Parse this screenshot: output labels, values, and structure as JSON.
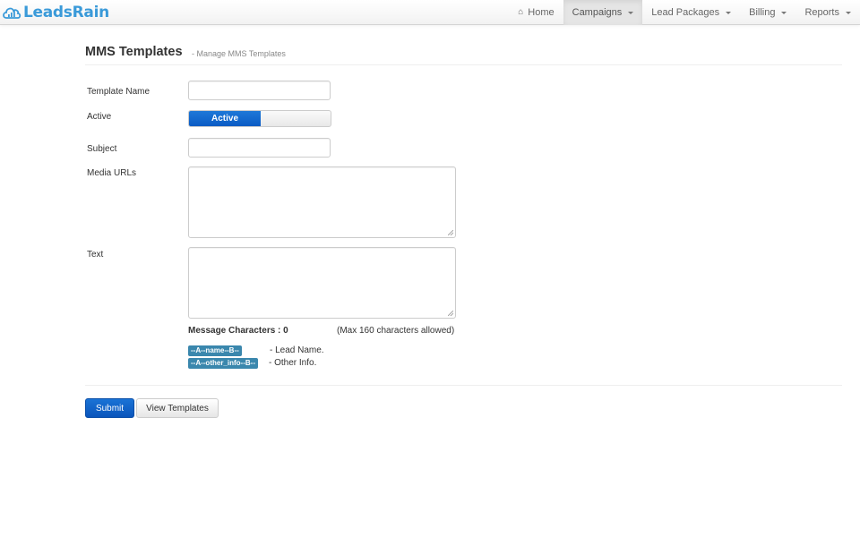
{
  "brand": {
    "name": "LeadsRain"
  },
  "nav": {
    "items": [
      {
        "label": "Home",
        "icon": "home-icon",
        "dropdown": false,
        "active": false
      },
      {
        "label": "Campaigns",
        "dropdown": true,
        "active": true
      },
      {
        "label": "Lead Packages",
        "dropdown": true,
        "active": false
      },
      {
        "label": "Billing",
        "dropdown": true,
        "active": false
      },
      {
        "label": "Reports",
        "dropdown": true,
        "active": false
      }
    ]
  },
  "header": {
    "title": "MMS Templates",
    "subtitle": "- Manage MMS Templates"
  },
  "form": {
    "template_name": {
      "label": "Template Name",
      "value": "",
      "placeholder": ""
    },
    "active": {
      "label": "Active",
      "toggle_label": "Active",
      "state": "on"
    },
    "subject": {
      "label": "Subject",
      "value": "",
      "placeholder": ""
    },
    "media_urls": {
      "label": "Media URLs",
      "value": ""
    },
    "text": {
      "label": "Text",
      "value": ""
    },
    "message_characters": "Message Characters : 0",
    "max_characters": "(Max 160 characters allowed)",
    "placeholders": [
      {
        "tag": "--A--name--B--",
        "description": "- Lead Name."
      },
      {
        "tag": "--A--other_info--B--",
        "description": "- Other Info."
      }
    ]
  },
  "actions": {
    "submit_label": "Submit",
    "view_templates_label": "View Templates"
  },
  "colors": {
    "brand": "#3a9ad9",
    "primary": "#0a5bc4",
    "tag": "#3a87ad"
  }
}
